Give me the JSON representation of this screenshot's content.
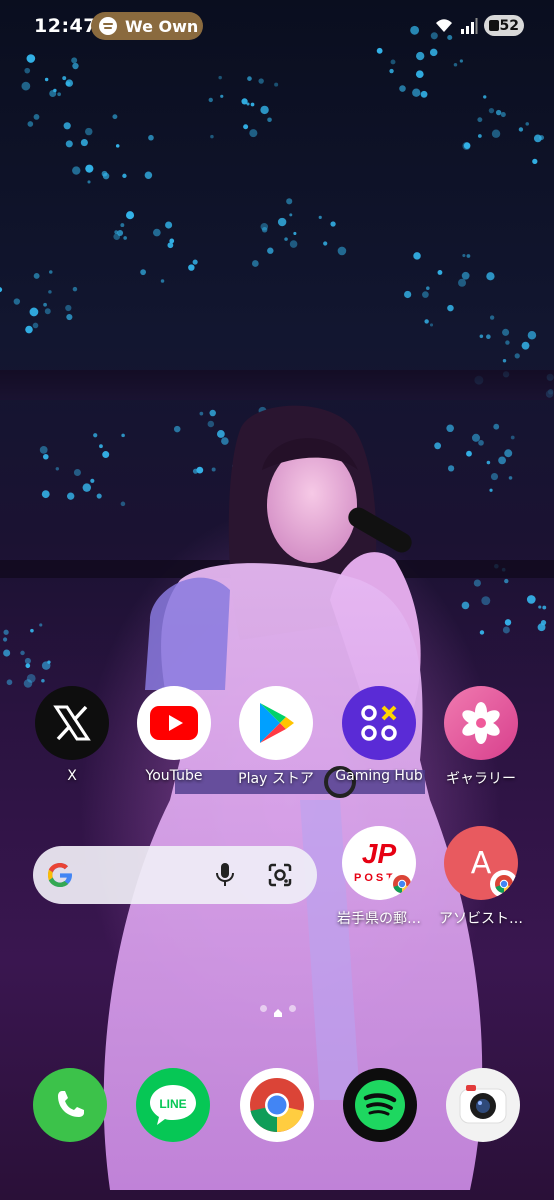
{
  "status_bar": {
    "time": "12:47",
    "media_chip": "We Own",
    "battery": "52"
  },
  "apps": [
    {
      "name": "x",
      "label": "X"
    },
    {
      "name": "youtube",
      "label": "YouTube"
    },
    {
      "name": "play-store",
      "label": "Play ストア"
    },
    {
      "name": "gaming-hub",
      "label": "Gaming Hub"
    },
    {
      "name": "gallery",
      "label": "ギャラリー"
    }
  ],
  "shortcuts": [
    {
      "name": "japan-post",
      "label": "岩手県の郵…",
      "icon_text": "JP",
      "icon_sub": "POST"
    },
    {
      "name": "asobistore",
      "label": "アソビスト…",
      "icon_text": "A"
    }
  ],
  "search_widget": {
    "logo": "G"
  },
  "dock": [
    "phone",
    "line",
    "chrome",
    "spotify",
    "camera"
  ],
  "dock_labels": {
    "line": "LINE"
  },
  "colors": {
    "youtube_red": "#ff0000",
    "line_green": "#06c755",
    "spotify_green": "#1ed760",
    "gaming_purple": "#5a2bd6",
    "jp_red": "#e60012"
  }
}
